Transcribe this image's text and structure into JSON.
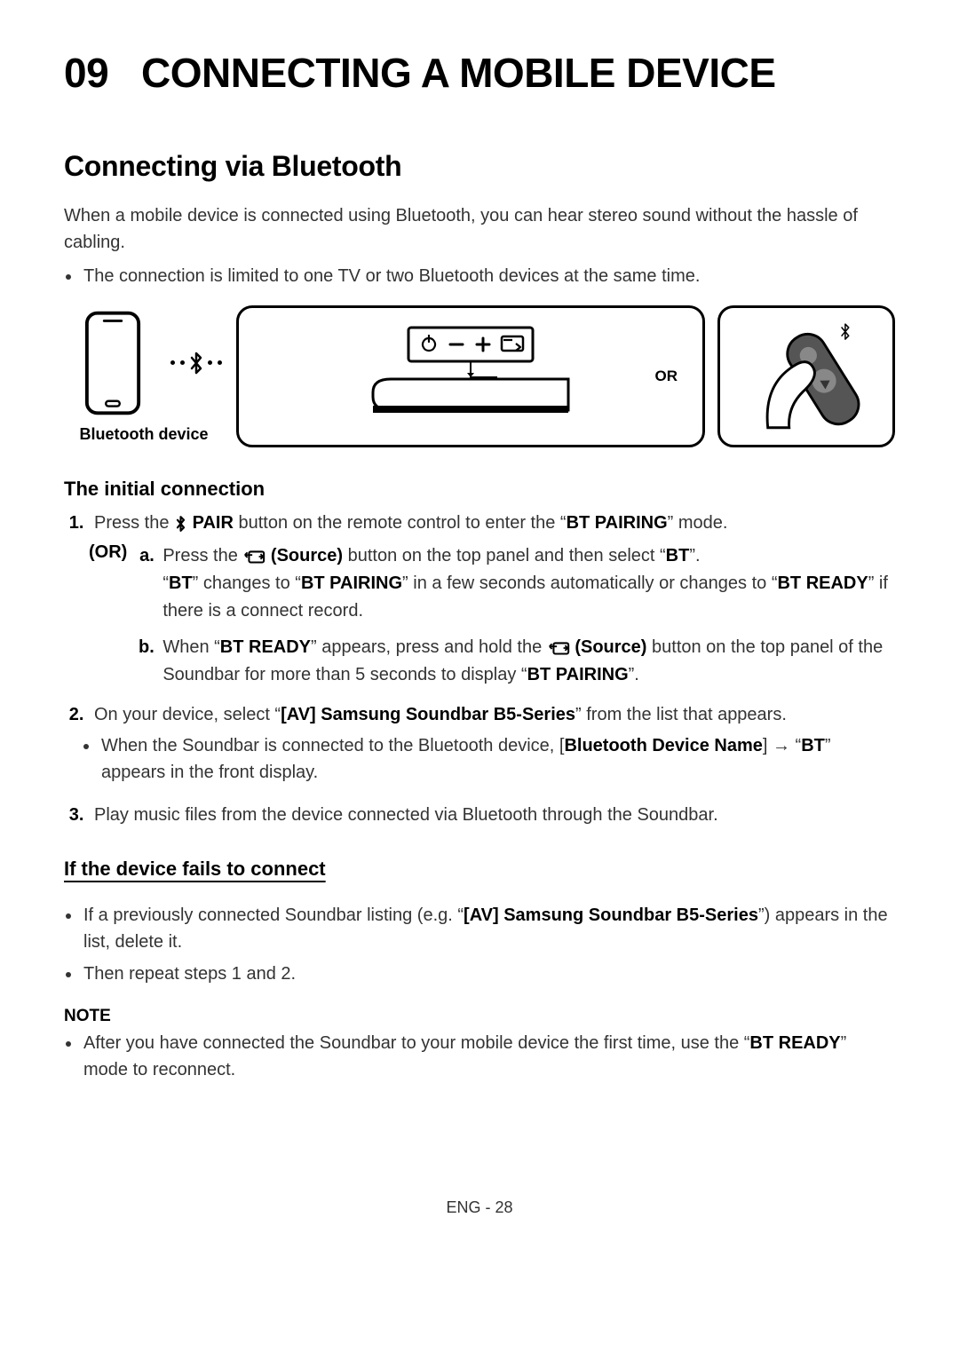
{
  "chapter": {
    "number": "09",
    "title": "CONNECTING A MOBILE DEVICE"
  },
  "section": {
    "title": "Connecting via Bluetooth"
  },
  "intro": "When a mobile device is connected using Bluetooth, you can hear stereo sound without the hassle of cabling.",
  "intro_bullet": "The connection is limited to one TV or two Bluetooth devices at the same time.",
  "diagram": {
    "phone_label": "Bluetooth device",
    "or": "OR"
  },
  "sub1": {
    "title": "The initial connection",
    "step1_a": "Press the ",
    "step1_pair": " PAIR",
    "step1_b": " button on the remote control to enter the “",
    "step1_mode": "BT PAIRING",
    "step1_c": "” mode.",
    "or_label": "(OR)",
    "a_pre": "Press the ",
    "a_source": " (Source)",
    "a_post": " button on the top panel and then select “",
    "a_bt": "BT",
    "a_end": "”.",
    "a_line2_a": "“",
    "a_line2_bt": "BT",
    "a_line2_b": "” changes to “",
    "a_line2_pairing": "BT PAIRING",
    "a_line2_c": "” in a few seconds automatically or changes to “",
    "a_line2_ready": "BT READY",
    "a_line2_d": "” if there is a connect record.",
    "b_a": "When “",
    "b_ready": "BT READY",
    "b_b": "” appears, press and hold the ",
    "b_source": " (Source)",
    "b_c": " button on the top panel of the Soundbar for more than 5 seconds to display “",
    "b_pairing": "BT PAIRING",
    "b_d": "”.",
    "step2_a": "On your device, select “",
    "step2_name": "[AV] Samsung Soundbar B5-Series",
    "step2_b": "” from the list that appears.",
    "step2_bullet_a": "When the Soundbar is connected to the Bluetooth device, [",
    "step2_bullet_name": "Bluetooth Device Name",
    "step2_bullet_b": "] → “",
    "step2_bullet_bt": "BT",
    "step2_bullet_c": "” appears in the front display.",
    "step3": "Play music files from the device connected via Bluetooth through the Soundbar."
  },
  "sub2": {
    "title": "If the device fails to connect",
    "bullet1_a": "If a previously connected Soundbar listing (e.g. “",
    "bullet1_name": "[AV] Samsung Soundbar B5-Series",
    "bullet1_b": "”) appears in the list, delete it.",
    "bullet2": "Then repeat steps 1 and 2."
  },
  "note": {
    "title": "NOTE",
    "bullet_a": "After you have connected the Soundbar to your mobile device the first time, use the “",
    "bullet_ready": "BT READY",
    "bullet_b": "” mode to reconnect."
  },
  "footer": "ENG - 28"
}
